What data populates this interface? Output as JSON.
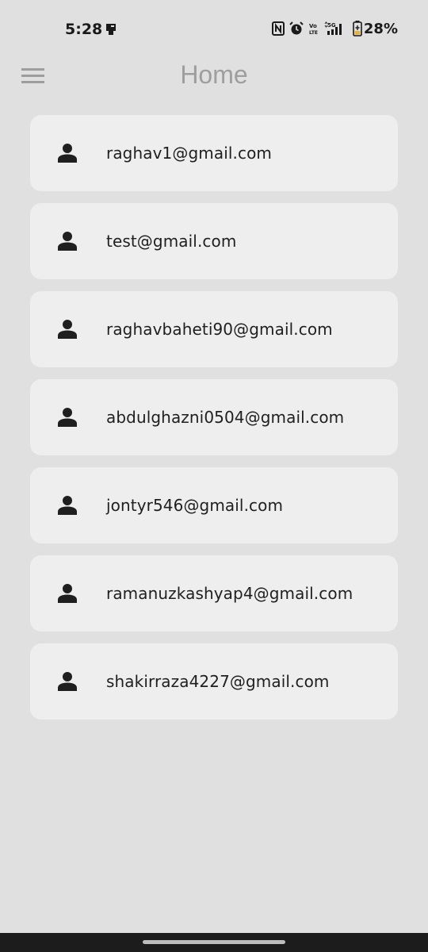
{
  "status_bar": {
    "time": "5:28",
    "battery": "28%",
    "icons": [
      "notification-icon",
      "nfc-icon",
      "alarm-icon",
      "volte-icon",
      "5g-signal-icon",
      "battery-icon"
    ]
  },
  "app_bar": {
    "title": "Home",
    "menu_icon": "hamburger-menu-icon"
  },
  "users": [
    {
      "email": "raghav1@gmail.com",
      "icon": "person-icon"
    },
    {
      "email": "test@gmail.com",
      "icon": "person-icon"
    },
    {
      "email": "raghavbaheti90@gmail.com",
      "icon": "person-icon"
    },
    {
      "email": "abdulghazni0504@gmail.com",
      "icon": "person-icon"
    },
    {
      "email": "jontyr546@gmail.com",
      "icon": "person-icon"
    },
    {
      "email": "ramanuzkashyap4@gmail.com",
      "icon": "person-icon"
    },
    {
      "email": "shakirraza4227@gmail.com",
      "icon": "person-icon"
    }
  ],
  "colors": {
    "background": "#e0e0e0",
    "card": "#eeeeee",
    "title": "#9e9e9e",
    "text": "#1f1f1f"
  }
}
